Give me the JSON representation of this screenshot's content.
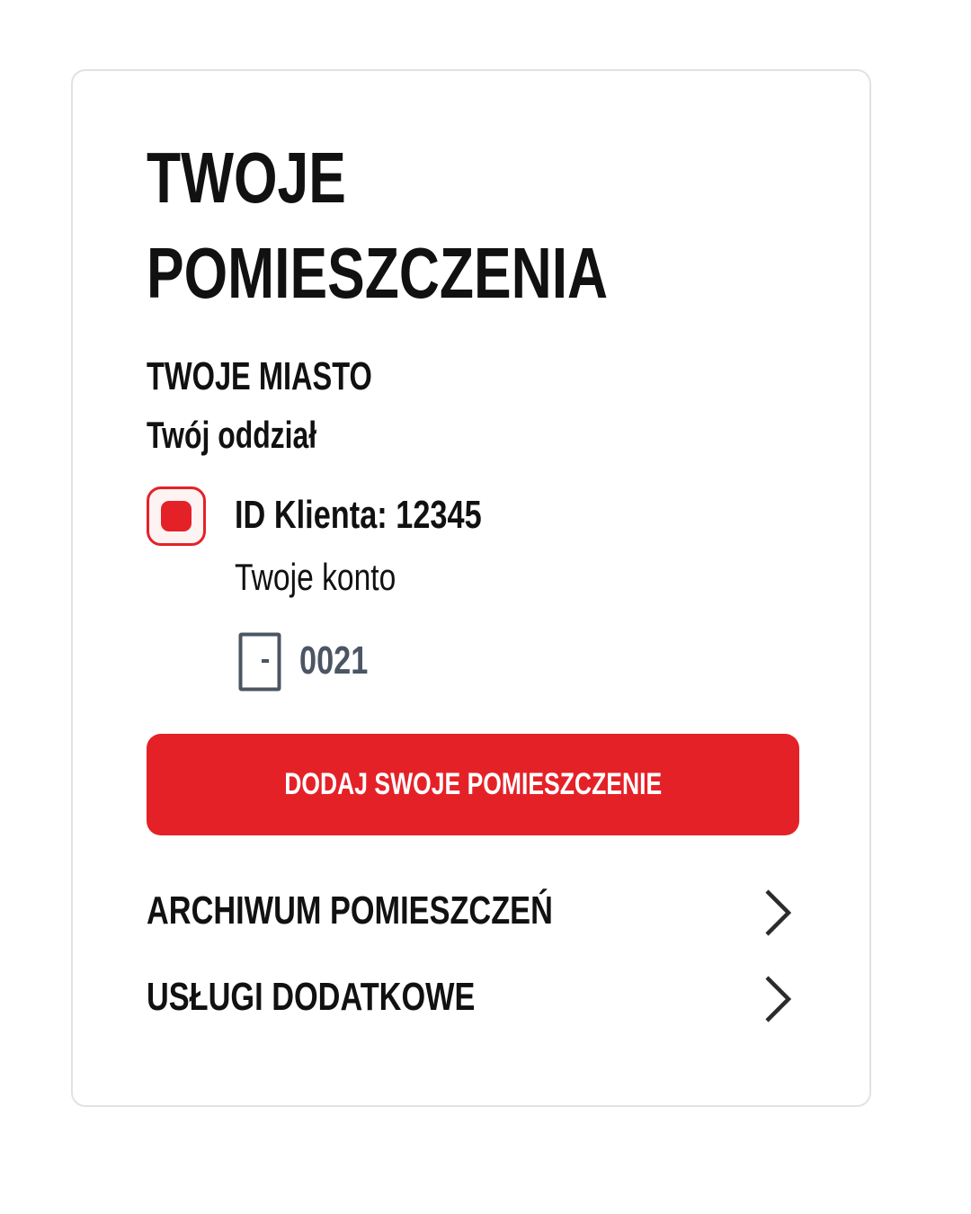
{
  "page": {
    "title_line1": "TWOJE",
    "title_line2": "POMIESZCZENIA"
  },
  "location": {
    "city": "TWOJE MIASTO",
    "branch": "Twój oddział"
  },
  "account": {
    "icon": "account-square-icon",
    "client_id_label": "ID Klienta: 12345",
    "account_name": "Twoje konto",
    "room_icon": "door-icon",
    "room_number": "0021"
  },
  "actions": {
    "add_room_label": "DODAJ SWOJE POMIESZCZENIE"
  },
  "links": [
    {
      "label": "ARCHIWUM POMIESZCZEŃ",
      "icon": "chevron-right-icon"
    },
    {
      "label": "USŁUGI DODATKOWE",
      "icon": "chevron-right-icon"
    }
  ],
  "colors": {
    "accent": "#e52128",
    "text": "#111111",
    "muted": "#4b5563",
    "border": "#e2e2e2"
  }
}
